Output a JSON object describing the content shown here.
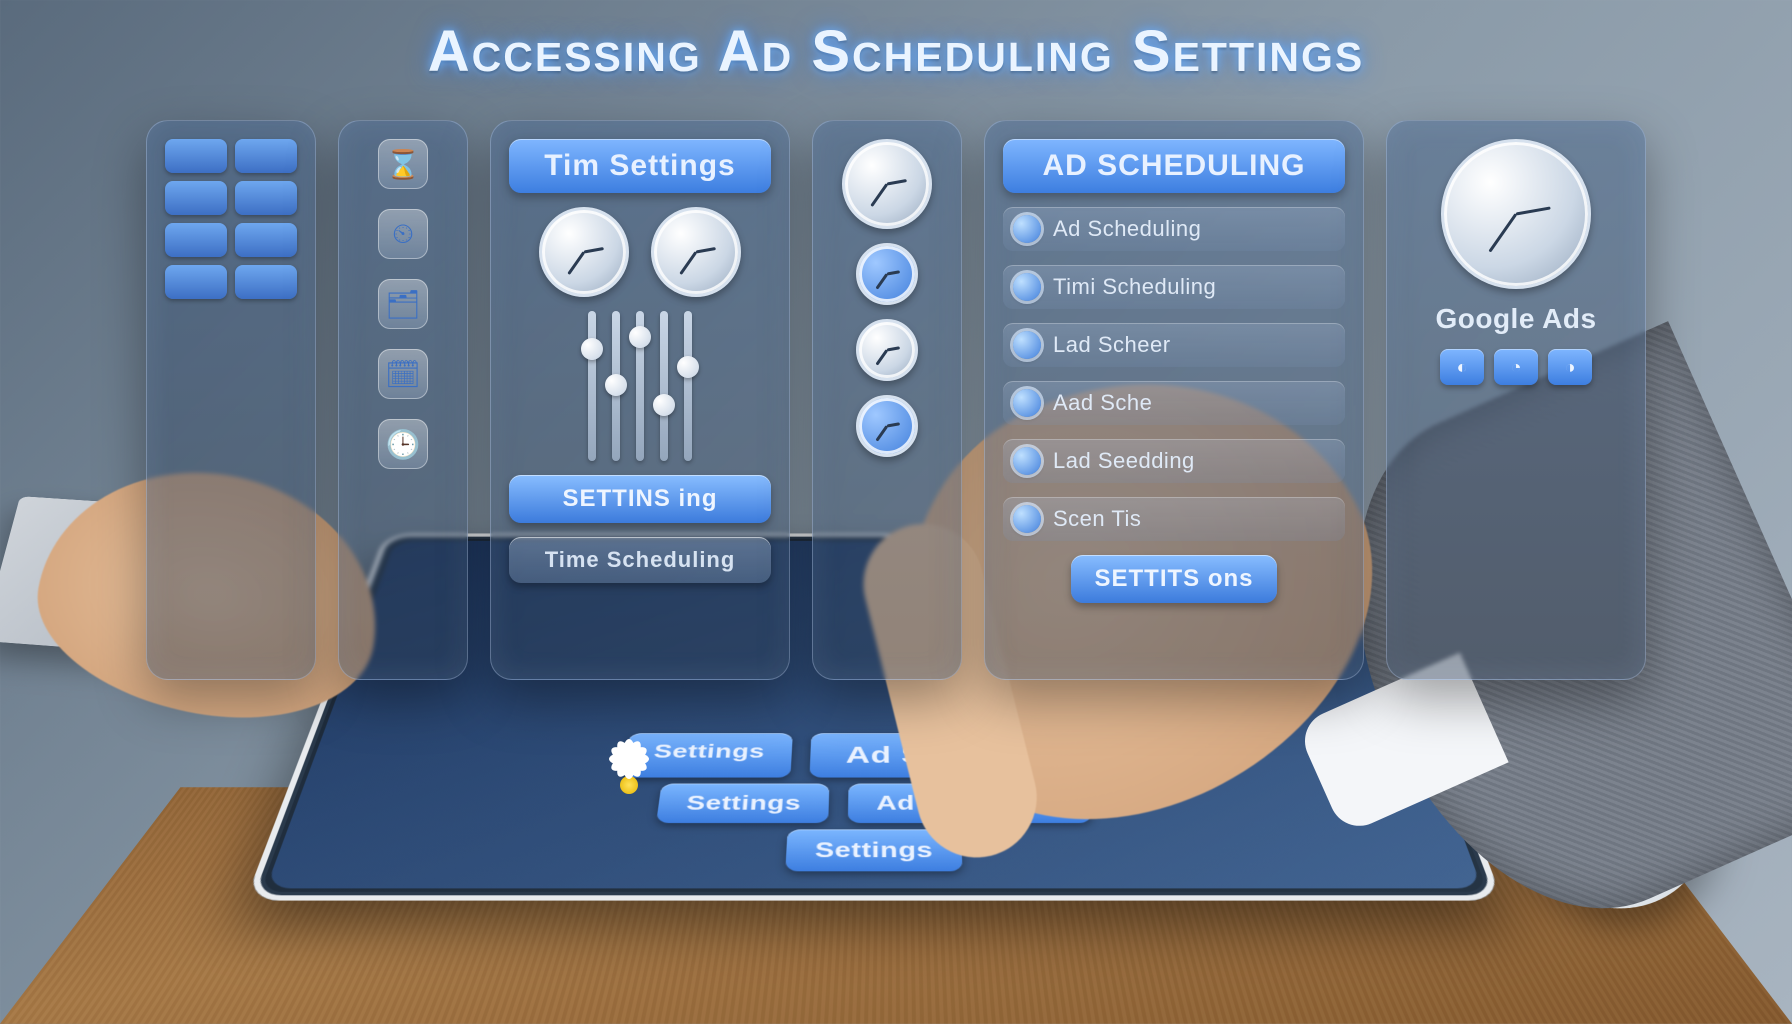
{
  "header": {
    "title": "Accessing Ad Scheduling Settings"
  },
  "panels": {
    "grid": {
      "cell_count": 8
    },
    "icons": {
      "glyphs": [
        "⌛",
        "⏲",
        "🗂",
        "🗓",
        "🕒"
      ]
    },
    "time": {
      "title": "Tim Settings",
      "button_primary": "SETTINS ing",
      "caption": "Time Scheduling"
    },
    "clocks": {
      "title": "",
      "count": 4
    },
    "schedule": {
      "title": "AD SCHEDULING",
      "items": [
        "Ad Scheduling",
        "Timi Scheduling",
        "Lad Scheer",
        "Aad Sche",
        "Lad Seedding",
        "Scen Tis"
      ],
      "button": "SETTITS ons"
    },
    "google": {
      "label": "Google Ads",
      "icons": [
        "◐",
        "◔",
        "◑"
      ]
    }
  },
  "tablet_bottom": {
    "row1": [
      "Settings",
      "Ad Scheduling"
    ],
    "row2": [
      "Settings",
      "Ad Sceduling"
    ],
    "row3": [
      "Settings"
    ]
  }
}
